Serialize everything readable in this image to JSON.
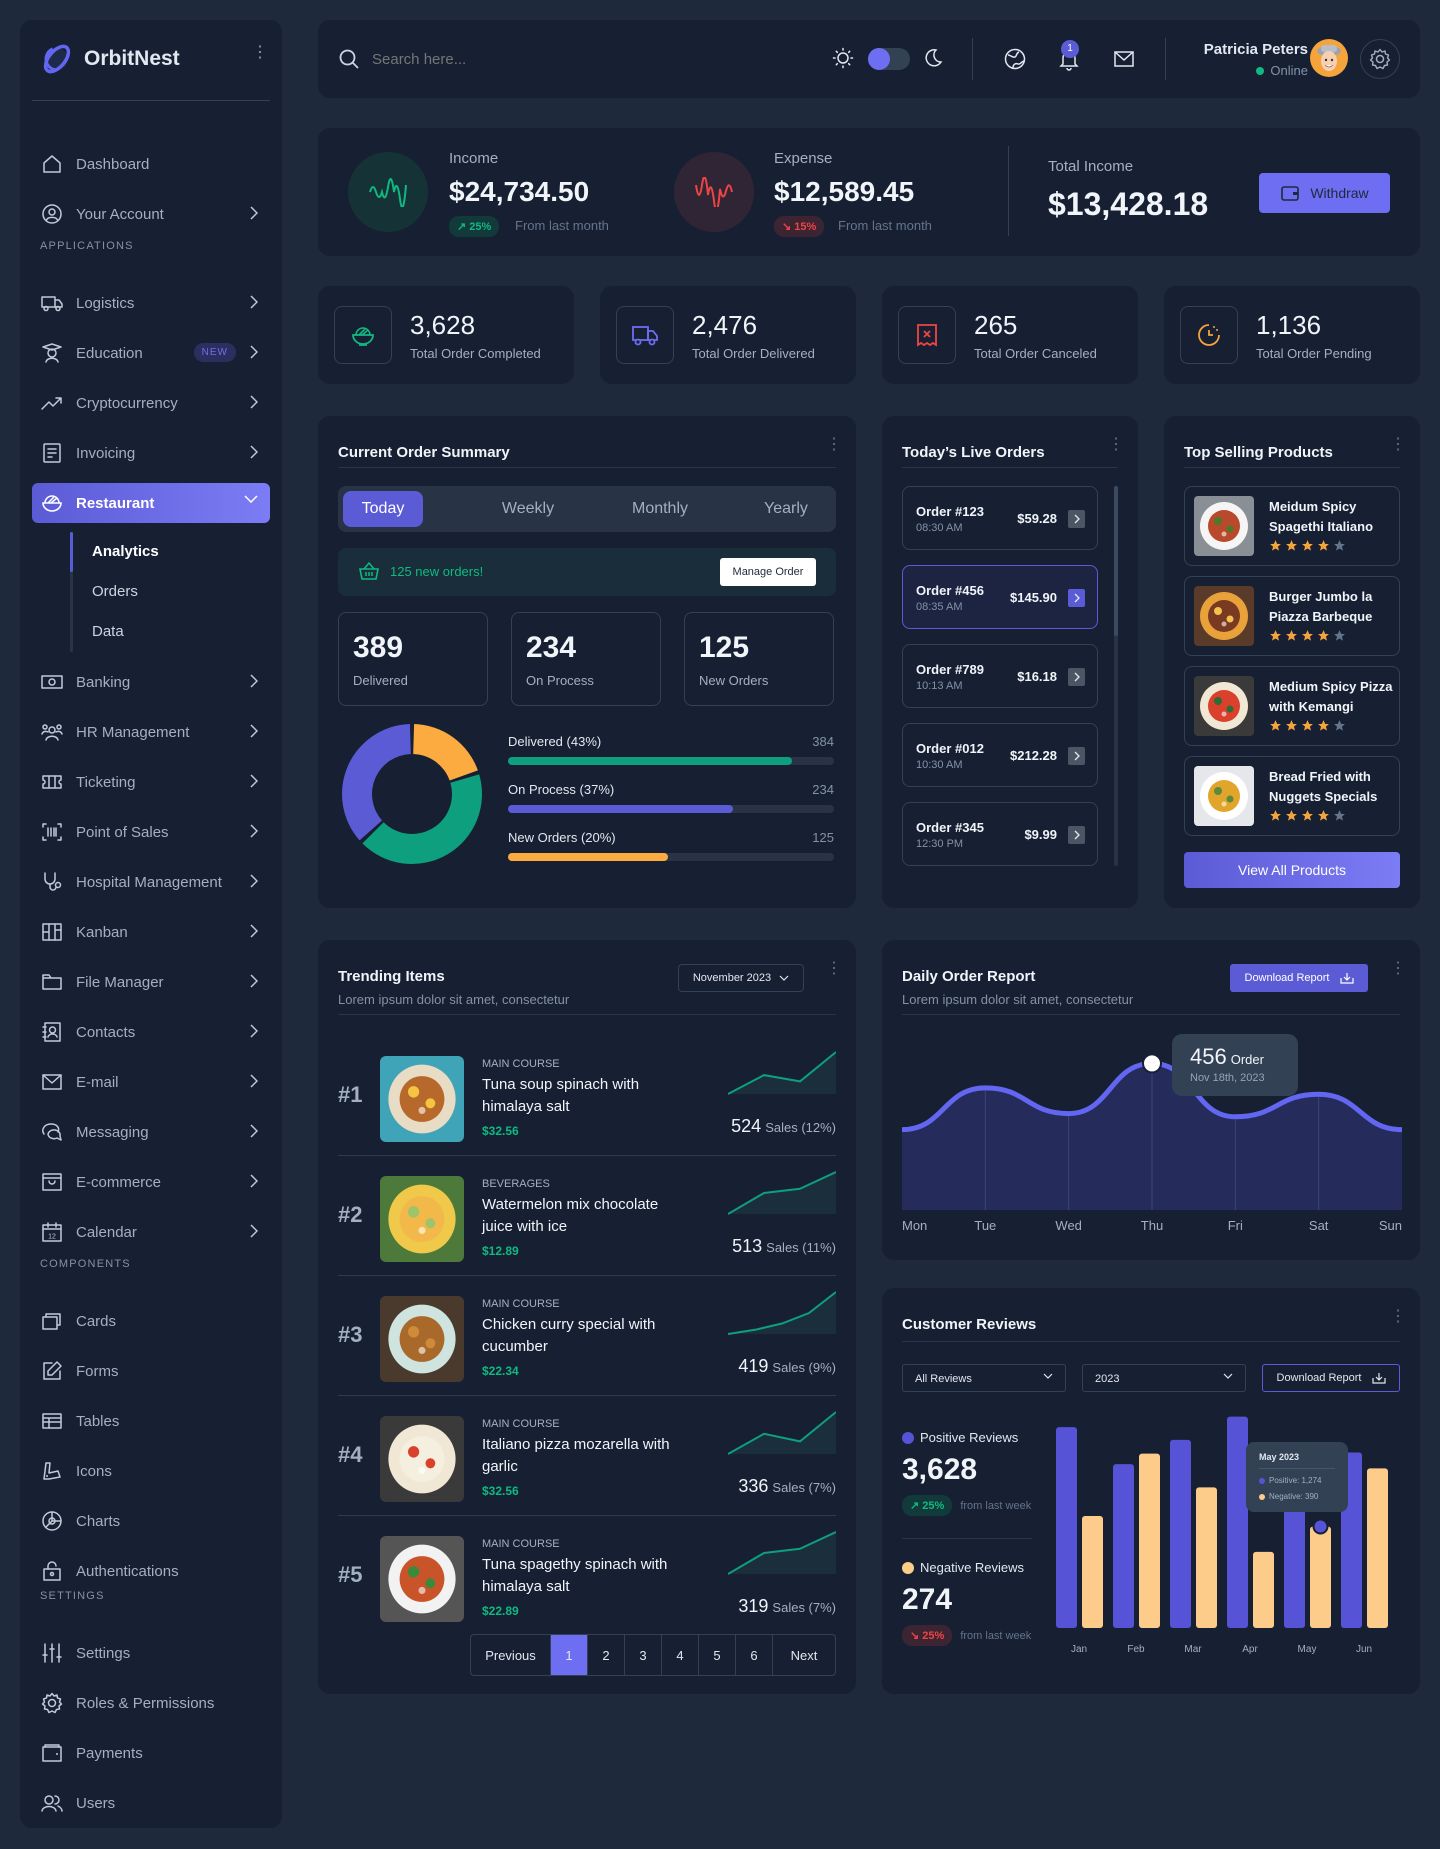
{
  "brand": {
    "name": "OrbitNest"
  },
  "sidebar": {
    "top_items": [
      {
        "label": "Dashboard",
        "icon": "home-icon"
      },
      {
        "label": "Your Account",
        "icon": "user-circle-icon"
      }
    ],
    "sections": {
      "applications": "APPLICATIONS",
      "components": "COMPONENTS",
      "settings": "SETTINGS"
    },
    "applications": [
      {
        "label": "Logistics",
        "icon": "truck-icon"
      },
      {
        "label": "Education",
        "icon": "student-icon",
        "badge": "NEW"
      },
      {
        "label": "Cryptocurrency",
        "icon": "trending-up-icon"
      },
      {
        "label": "Invoicing",
        "icon": "invoice-icon"
      },
      {
        "label": "Restaurant",
        "icon": "bowl-icon",
        "active": true
      },
      {
        "label": "Banking",
        "icon": "cash-icon"
      },
      {
        "label": "HR Management",
        "icon": "users-group-icon"
      },
      {
        "label": "Ticketing",
        "icon": "ticket-icon"
      },
      {
        "label": "Point of Sales",
        "icon": "barcode-icon"
      },
      {
        "label": "Hospital Management",
        "icon": "stethoscope-icon"
      },
      {
        "label": "Kanban",
        "icon": "kanban-icon"
      },
      {
        "label": "File Manager",
        "icon": "folder-icon"
      },
      {
        "label": "Contacts",
        "icon": "contact-book-icon"
      },
      {
        "label": "E-mail",
        "icon": "mail-icon"
      },
      {
        "label": "Messaging",
        "icon": "chat-icon"
      },
      {
        "label": "E-commerce",
        "icon": "store-icon"
      },
      {
        "label": "Calendar",
        "icon": "calendar-icon"
      }
    ],
    "restaurant_sub": [
      "Analytics",
      "Orders",
      "Data"
    ],
    "components": [
      {
        "label": "Cards",
        "icon": "cards-icon"
      },
      {
        "label": "Forms",
        "icon": "edit-icon"
      },
      {
        "label": "Tables",
        "icon": "table-icon"
      },
      {
        "label": "Icons",
        "icon": "swatch-icon"
      },
      {
        "label": "Charts",
        "icon": "pie-chart-icon"
      },
      {
        "label": "Authentications",
        "icon": "lock-icon"
      }
    ],
    "settings": [
      {
        "label": "Settings",
        "icon": "sliders-icon"
      },
      {
        "label": "Roles & Permissions",
        "icon": "gear-icon"
      },
      {
        "label": "Payments",
        "icon": "wallet-icon"
      },
      {
        "label": "Users",
        "icon": "users-icon"
      }
    ]
  },
  "header": {
    "search_placeholder": "Search here...",
    "notification_count": "1",
    "user_name": "Patricia Peters",
    "user_status": "Online"
  },
  "finance": {
    "income_label": "Income",
    "income_value": "$24,734.50",
    "income_change": "25%",
    "income_from": "From last month",
    "expense_label": "Expense",
    "expense_value": "$12,589.45",
    "expense_change": "15%",
    "expense_from": "From last month",
    "total_label": "Total Income",
    "total_value": "$13,428.18",
    "withdraw_label": "Withdraw"
  },
  "stats": [
    {
      "value": "3,628",
      "label": "Total Order Completed",
      "color": "#10b981"
    },
    {
      "value": "2,476",
      "label": "Total Order Delivered",
      "color": "#6e6ef2"
    },
    {
      "value": "265",
      "label": "Total Order Canceled",
      "color": "#ef4444"
    },
    {
      "value": "1,136",
      "label": "Total Order Pending",
      "color": "#f4a43b"
    }
  ],
  "summary": {
    "title": "Current Order Summary",
    "tabs": [
      "Today",
      "Weekly",
      "Monthly",
      "Yearly"
    ],
    "active_tab": "Today",
    "new_orders_text": "125 new orders!",
    "manage_label": "Manage Order",
    "mini": [
      {
        "value": "389",
        "label": "Delivered"
      },
      {
        "value": "234",
        "label": "On Process"
      },
      {
        "value": "125",
        "label": "New Orders"
      }
    ],
    "progress": [
      {
        "label": "Delivered (43%)",
        "value": "384",
        "fraction": 0.87,
        "color": "#0e9f7e"
      },
      {
        "label": "On Process (37%)",
        "value": "234",
        "fraction": 0.69,
        "color": "#5b5bd6"
      },
      {
        "label": "New Orders (20%)",
        "value": "125",
        "fraction": 0.49,
        "color": "#fbab3f"
      }
    ],
    "donut": [
      {
        "name": "New Orders",
        "percent": 20,
        "color": "#fbab3f"
      },
      {
        "name": "Delivered",
        "percent": 43,
        "color": "#0e9f7e"
      },
      {
        "name": "On Process",
        "percent": 37,
        "color": "#5b5bd6"
      }
    ]
  },
  "live_orders": {
    "title": "Today’s Live Orders",
    "orders": [
      {
        "id": "Order #123",
        "time": "08:30 AM",
        "amount": "$59.28"
      },
      {
        "id": "Order #456",
        "time": "08:35 AM",
        "amount": "$145.90",
        "selected": true
      },
      {
        "id": "Order #789",
        "time": "10:13 AM",
        "amount": "$16.18"
      },
      {
        "id": "Order #012",
        "time": "10:30 AM",
        "amount": "$212.28"
      },
      {
        "id": "Order #345",
        "time": "12:30 PM",
        "amount": "$9.99"
      }
    ]
  },
  "top_selling": {
    "title": "Top Selling Products",
    "products": [
      {
        "name": "Meidum Spicy Spagethi Italiano",
        "rating": 4
      },
      {
        "name": "Burger Jumbo la Piazza Barbeque",
        "rating": 4
      },
      {
        "name": "Medium Spicy Pizza with Kemangi",
        "rating": 4
      },
      {
        "name": "Bread Fried with Nuggets Specials",
        "rating": 4
      }
    ],
    "view_all_label": "View All Products"
  },
  "trending": {
    "title": "Trending Items",
    "subtitle": "Lorem ipsum dolor sit amet, consectetur",
    "month": "November 2023",
    "items": [
      {
        "rank": "#1",
        "category": "MAIN COURSE",
        "name": "Tuna soup spinach with himalaya salt",
        "price": "$32.56",
        "sales": "524",
        "sales_label": "Sales (12%)",
        "trend": [
          0,
          0.45,
          0.3,
          1
        ]
      },
      {
        "rank": "#2",
        "category": "BEVERAGES",
        "name": "Watermelon mix chocolate juice with ice",
        "price": "$12.89",
        "sales": "513",
        "sales_label": "Sales (11%)",
        "trend": [
          0,
          0.5,
          0.6,
          1
        ]
      },
      {
        "rank": "#3",
        "category": "MAIN COURSE",
        "name": "Chicken curry special with cucumber",
        "price": "$22.34",
        "sales": "419",
        "sales_label": "Sales (9%)",
        "trend": [
          0,
          0.1,
          0.25,
          0.5,
          1
        ]
      },
      {
        "rank": "#4",
        "category": "MAIN COURSE",
        "name": "Italiano pizza mozarella with garlic",
        "price": "$32.56",
        "sales": "336",
        "sales_label": "Sales (7%)",
        "trend": [
          0,
          0.48,
          0.3,
          1
        ]
      },
      {
        "rank": "#5",
        "category": "MAIN COURSE",
        "name": "Tuna spagethy spinach with himalaya salt",
        "price": "$22.89",
        "sales": "319",
        "sales_label": "Sales (7%)",
        "trend": [
          0,
          0.5,
          0.6,
          1
        ]
      }
    ],
    "pagination": {
      "previous": "Previous",
      "pages": [
        "1",
        "2",
        "3",
        "4",
        "5",
        "6"
      ],
      "current": "1",
      "next": "Next"
    }
  },
  "daily": {
    "title": "Daily Order Report",
    "subtitle": "Lorem ipsum dolor sit amet, consectetur",
    "download_label": "Download Report",
    "tooltip_value": "456",
    "tooltip_unit": "Order",
    "tooltip_date": "Nov 18th, 2023"
  },
  "reviews": {
    "title": "Customer Reviews",
    "filter": "All Reviews",
    "year": "2023",
    "download_label": "Download Report",
    "positive_label": "Positive Reviews",
    "positive_value": "3,628",
    "positive_change": "25%",
    "negative_label": "Negative Reviews",
    "negative_value": "274",
    "negative_change": "25%",
    "from_text": "from last week",
    "tooltip_title": "May 2023",
    "tooltip_positive": "Positive: 1,274",
    "tooltip_negative": "Negative: 390"
  },
  "chart_data": [
    {
      "type": "area",
      "title": "Daily Order Report",
      "categories": [
        "Mon",
        "Tue",
        "Wed",
        "Thu",
        "Fri",
        "Sat",
        "Sun"
      ],
      "values": [
        250,
        380,
        300,
        456,
        290,
        360,
        250
      ],
      "ylim": [
        0,
        560
      ],
      "grid": false,
      "annotation": {
        "category": "Thu",
        "value": 456,
        "text": "456 Order Nov 18th, 2023"
      }
    },
    {
      "type": "bar",
      "title": "Customer Reviews",
      "categories": [
        "Jan",
        "Feb",
        "Mar",
        "Apr",
        "May",
        "Jun"
      ],
      "series": [
        {
          "name": "Positive",
          "color": "#5753d6",
          "values": [
            1900,
            1550,
            1780,
            2000,
            1274,
            1660
          ]
        },
        {
          "name": "Negative",
          "color": "#fdcb8a",
          "values": [
            1060,
            1650,
            1330,
            720,
            960,
            1510
          ]
        }
      ],
      "ylim": [
        0,
        2100
      ],
      "legend": "left",
      "annotation": {
        "category": "May",
        "text": "May 2023 Positive: 1,274 Negative: 390"
      }
    },
    {
      "type": "pie",
      "title": "Current Order Summary",
      "categories": [
        "New Orders",
        "Delivered",
        "On Process"
      ],
      "values": [
        20,
        43,
        37
      ]
    }
  ]
}
